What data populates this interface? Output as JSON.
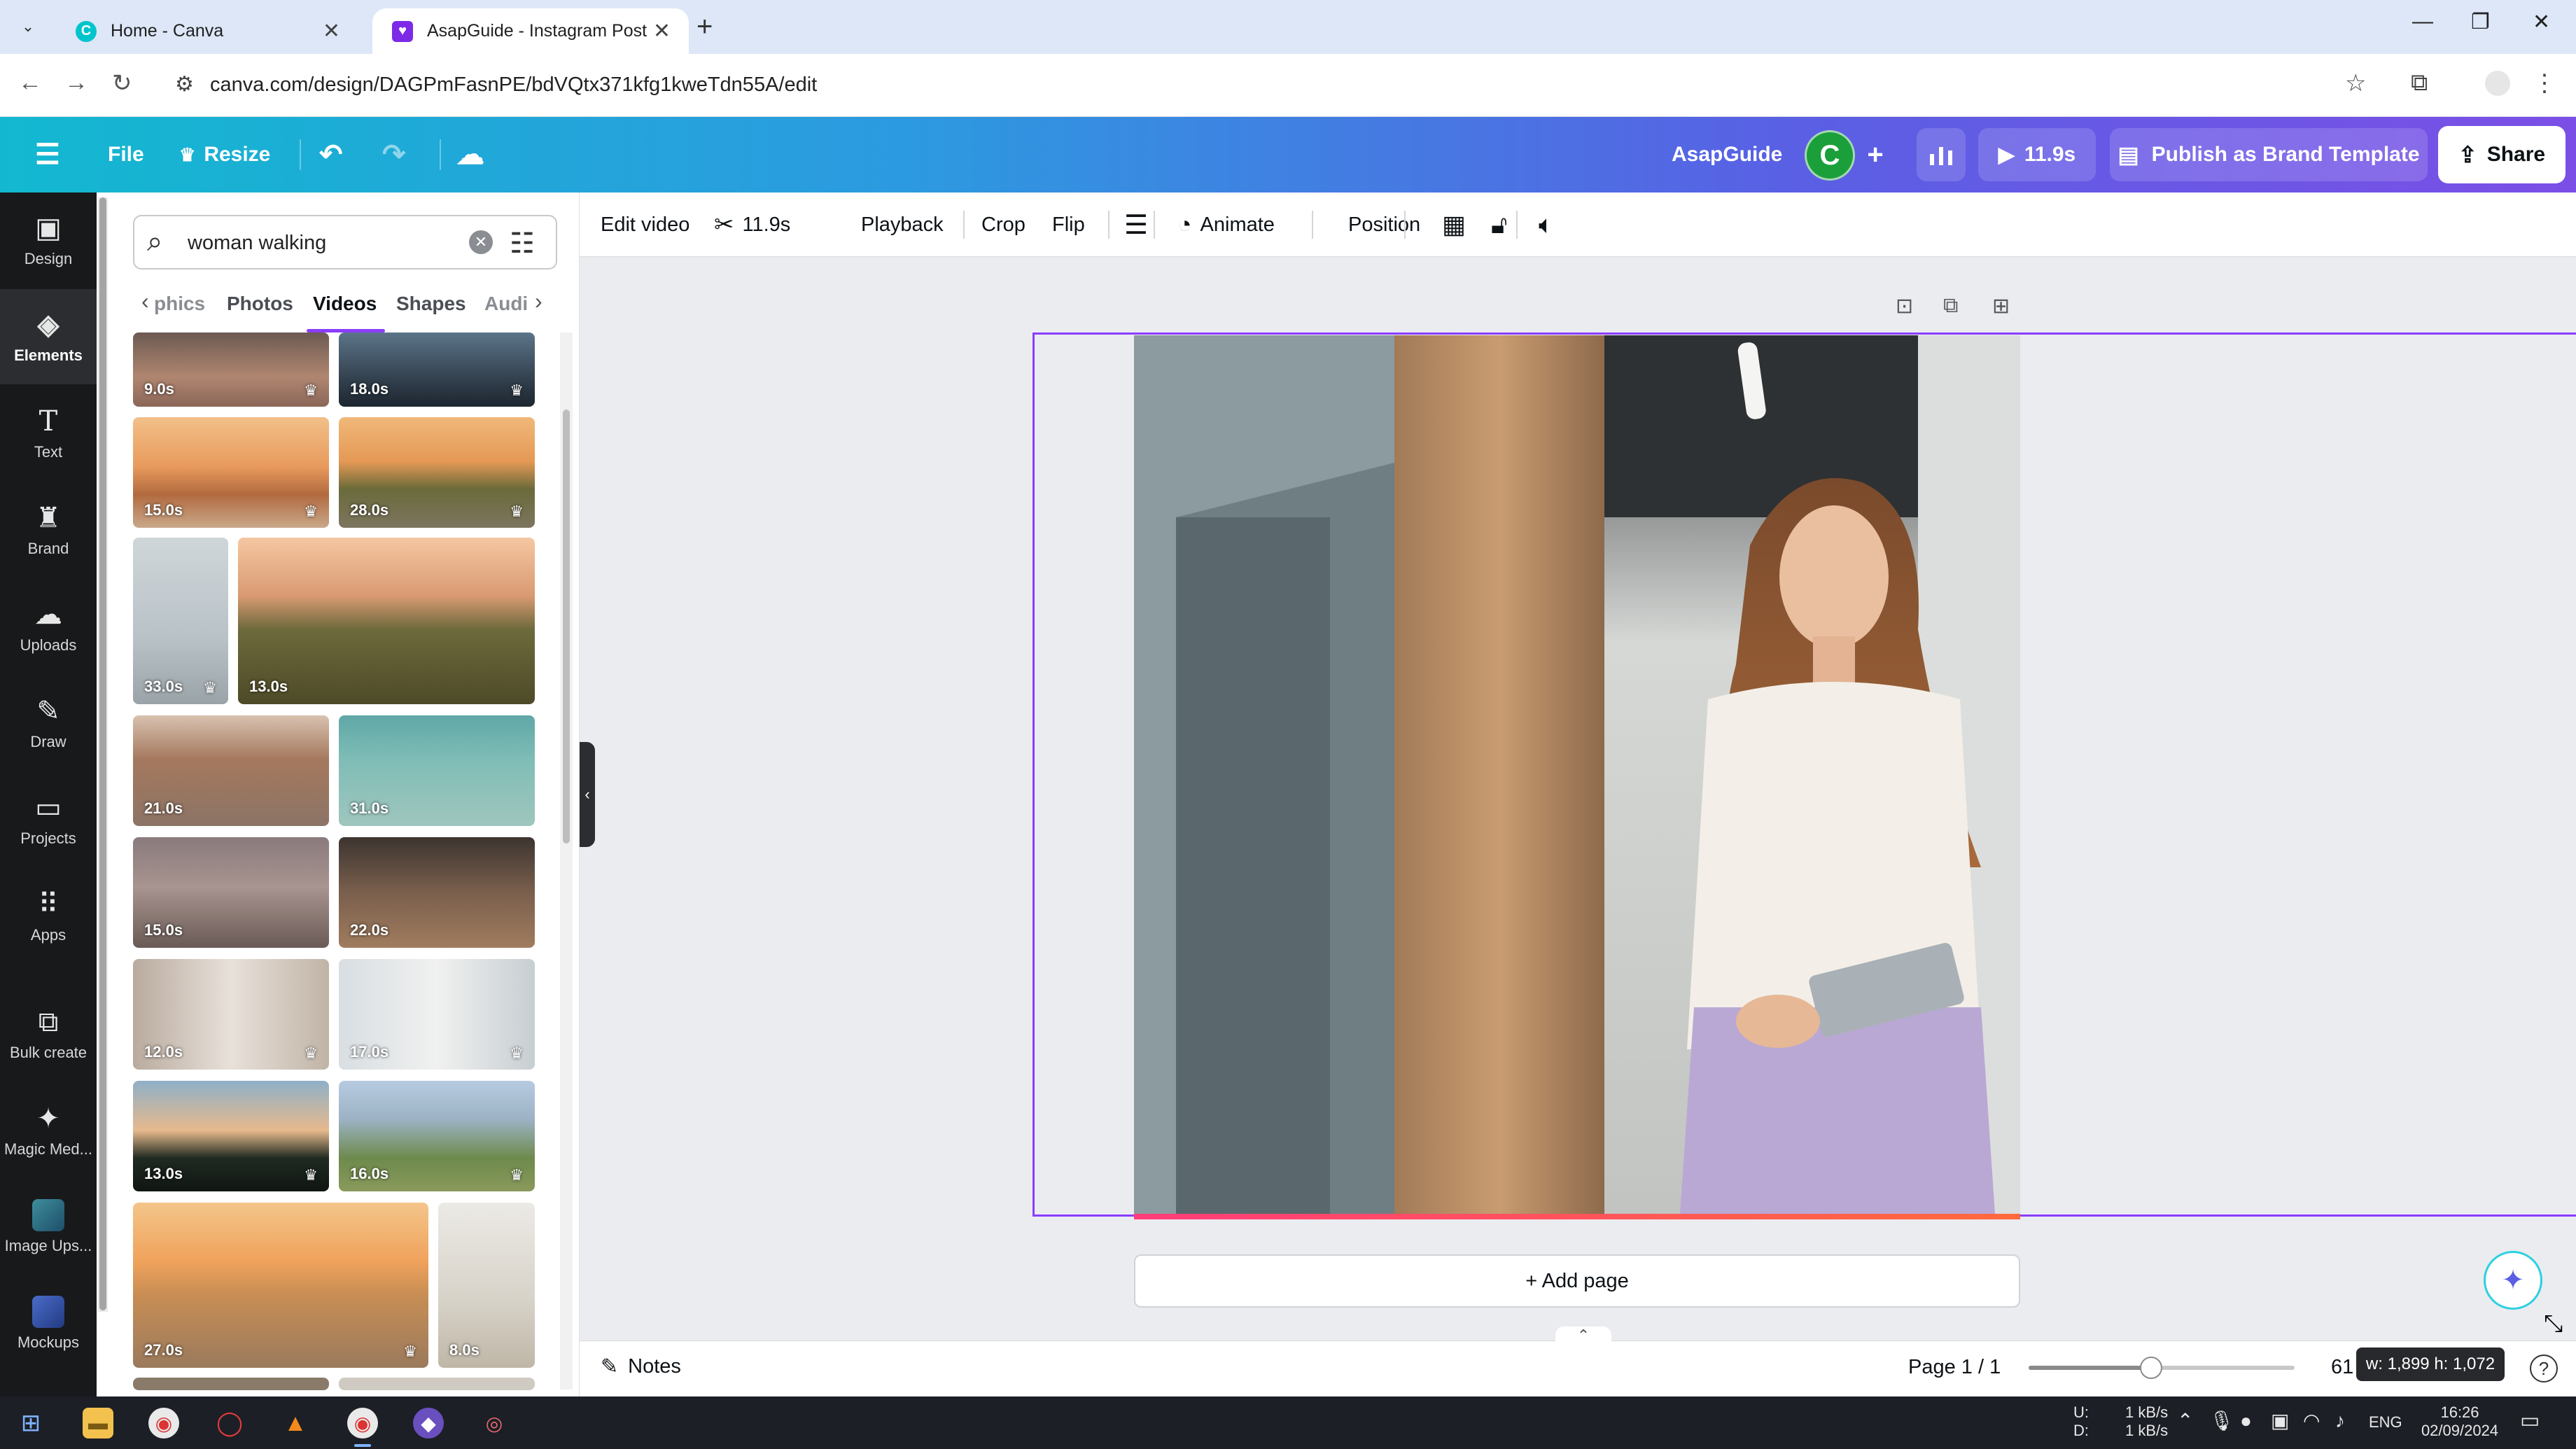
{
  "browser": {
    "tabs": [
      {
        "title": "Home - Canva",
        "active": false
      },
      {
        "title": "AsapGuide - Instagram Post",
        "active": true
      }
    ],
    "url": "canva.com/design/DAGPmFasnPE/bdVQtx371kfg1kweTdn55A/edit"
  },
  "header": {
    "file_label": "File",
    "resize_label": "Resize",
    "team_name": "AsapGuide",
    "avatar_letter": "C",
    "play_duration": "11.9s",
    "publish_label": "Publish as Brand Template",
    "share_label": "Share"
  },
  "rail": {
    "items": [
      {
        "label": "Design",
        "icon": "design-icon"
      },
      {
        "label": "Elements",
        "icon": "elements-icon",
        "active": true
      },
      {
        "label": "Text",
        "icon": "text-icon"
      },
      {
        "label": "Brand",
        "icon": "brand-icon"
      },
      {
        "label": "Uploads",
        "icon": "uploads-icon"
      },
      {
        "label": "Draw",
        "icon": "draw-icon"
      },
      {
        "label": "Projects",
        "icon": "projects-icon"
      },
      {
        "label": "Apps",
        "icon": "apps-icon"
      },
      {
        "label": "Bulk create",
        "icon": "bulk-create-icon"
      },
      {
        "label": "Magic Med...",
        "icon": "magic-media-icon"
      },
      {
        "label": "Image Ups...",
        "icon": "image-upscaler-icon"
      },
      {
        "label": "Mockups",
        "icon": "mockups-icon"
      }
    ]
  },
  "panel": {
    "search_value": "woman walking",
    "tabs": [
      "phics",
      "Photos",
      "Videos",
      "Shapes",
      "Audi"
    ],
    "active_tab": "Videos",
    "videos": [
      {
        "duration": "9.0s",
        "premium": true
      },
      {
        "duration": "18.0s",
        "premium": true
      },
      {
        "duration": "15.0s",
        "premium": true
      },
      {
        "duration": "28.0s",
        "premium": true
      },
      {
        "duration": "33.0s",
        "premium": true
      },
      {
        "duration": "13.0s",
        "premium": false
      },
      {
        "duration": "21.0s",
        "premium": false
      },
      {
        "duration": "31.0s",
        "premium": false
      },
      {
        "duration": "15.0s",
        "premium": false
      },
      {
        "duration": "22.0s",
        "premium": false
      },
      {
        "duration": "12.0s",
        "premium": true
      },
      {
        "duration": "17.0s",
        "premium": true
      },
      {
        "duration": "13.0s",
        "premium": true
      },
      {
        "duration": "16.0s",
        "premium": true
      },
      {
        "duration": "27.0s",
        "premium": true
      },
      {
        "duration": "8.0s",
        "premium": false
      }
    ]
  },
  "toolbar": {
    "edit_video": "Edit video",
    "trim_duration": "11.9s",
    "playback": "Playback",
    "crop": "Crop",
    "flip": "Flip",
    "animate": "Animate",
    "position": "Position"
  },
  "canvas": {
    "add_page_label": "+ Add page"
  },
  "footer": {
    "notes_label": "Notes",
    "page_count": "Page 1 / 1",
    "zoom_value": "61",
    "zoom_fraction": 0.46,
    "dimension_tip": "w: 1,899 h: 1,072"
  },
  "taskbar": {
    "net_up_label": "U:",
    "net_down_label": "D:",
    "net_up": "1 kB/s",
    "net_down": "1 kB/s",
    "language": "ENG",
    "time": "16:26",
    "date": "02/09/2024"
  }
}
